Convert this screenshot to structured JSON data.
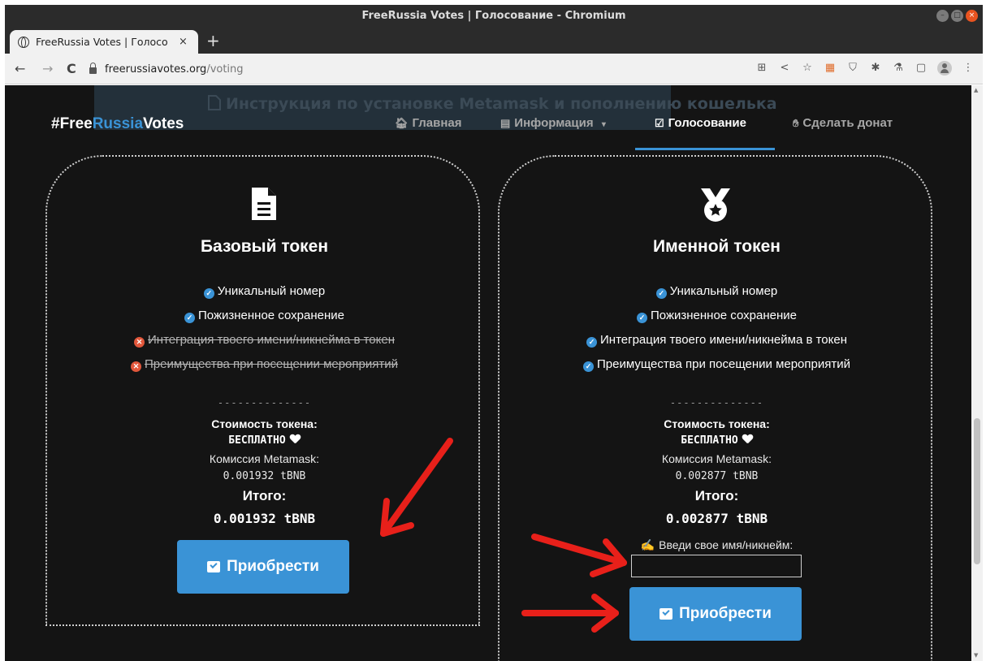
{
  "window": {
    "title": "FreeRussia Votes | Голосование - Chromium"
  },
  "tab": {
    "title": "FreeRussia Votes | Голосо",
    "close": "×",
    "new_tab": "+"
  },
  "toolbar": {
    "back": "←",
    "forward": "→",
    "reload": "C",
    "url_host": "freerussiavotes.org",
    "url_path": "/voting"
  },
  "banner": {
    "text": "Инструкция по установке Metamask и пополнению кошелька"
  },
  "site": {
    "logo_prefix": "#Free",
    "logo_accent": "Russia",
    "logo_suffix": "Votes",
    "nav": [
      {
        "label": "Главная",
        "icon": "home-icon"
      },
      {
        "label": "Информация",
        "icon": "document-icon",
        "caret": "▾"
      },
      {
        "label": "Голосование",
        "icon": "vote-icon",
        "active": true
      },
      {
        "label": "Сделать донат",
        "icon": "donate-icon"
      }
    ]
  },
  "cards": [
    {
      "title": "Базовый токен",
      "icon": "document-icon",
      "features": [
        {
          "text": "Уникальный номер",
          "included": true
        },
        {
          "text": "Пожизненное сохранение",
          "included": true
        },
        {
          "text": "Интеграция твоего имени/никнейма в токен",
          "included": false
        },
        {
          "text": "Преимущества при посещении мероприятий",
          "included": false
        }
      ],
      "separator": "--------------",
      "price_label": "Стоимость токена:",
      "price_value": "БЕСПЛАТНО",
      "fee_label": "Комиссия Metamask:",
      "fee_value": "0.001932 tBNB",
      "total_label": "Итого:",
      "total_value": "0.001932 tBNB",
      "button": "Приобрести"
    },
    {
      "title": "Именной токен",
      "icon": "medal-icon",
      "features": [
        {
          "text": "Уникальный номер",
          "included": true
        },
        {
          "text": "Пожизненное сохранение",
          "included": true
        },
        {
          "text": "Интеграция твоего имени/никнейма в токен",
          "included": true
        },
        {
          "text": "Преимущества при посещении мероприятий",
          "included": true
        }
      ],
      "separator": "--------------",
      "price_label": "Стоимость токена:",
      "price_value": "БЕСПЛАТНО",
      "fee_label": "Комиссия Metamask:",
      "fee_value": "0.002877 tBNB",
      "total_label": "Итого:",
      "total_value": "0.002877 tBNB",
      "name_label": "Введи свое имя/никнейм:",
      "name_value": "",
      "button": "Приобрести"
    }
  ],
  "colors": {
    "accent": "#3a93d6",
    "background": "#141414",
    "annotation": "#e8201a",
    "excluded": "#e2573b"
  }
}
